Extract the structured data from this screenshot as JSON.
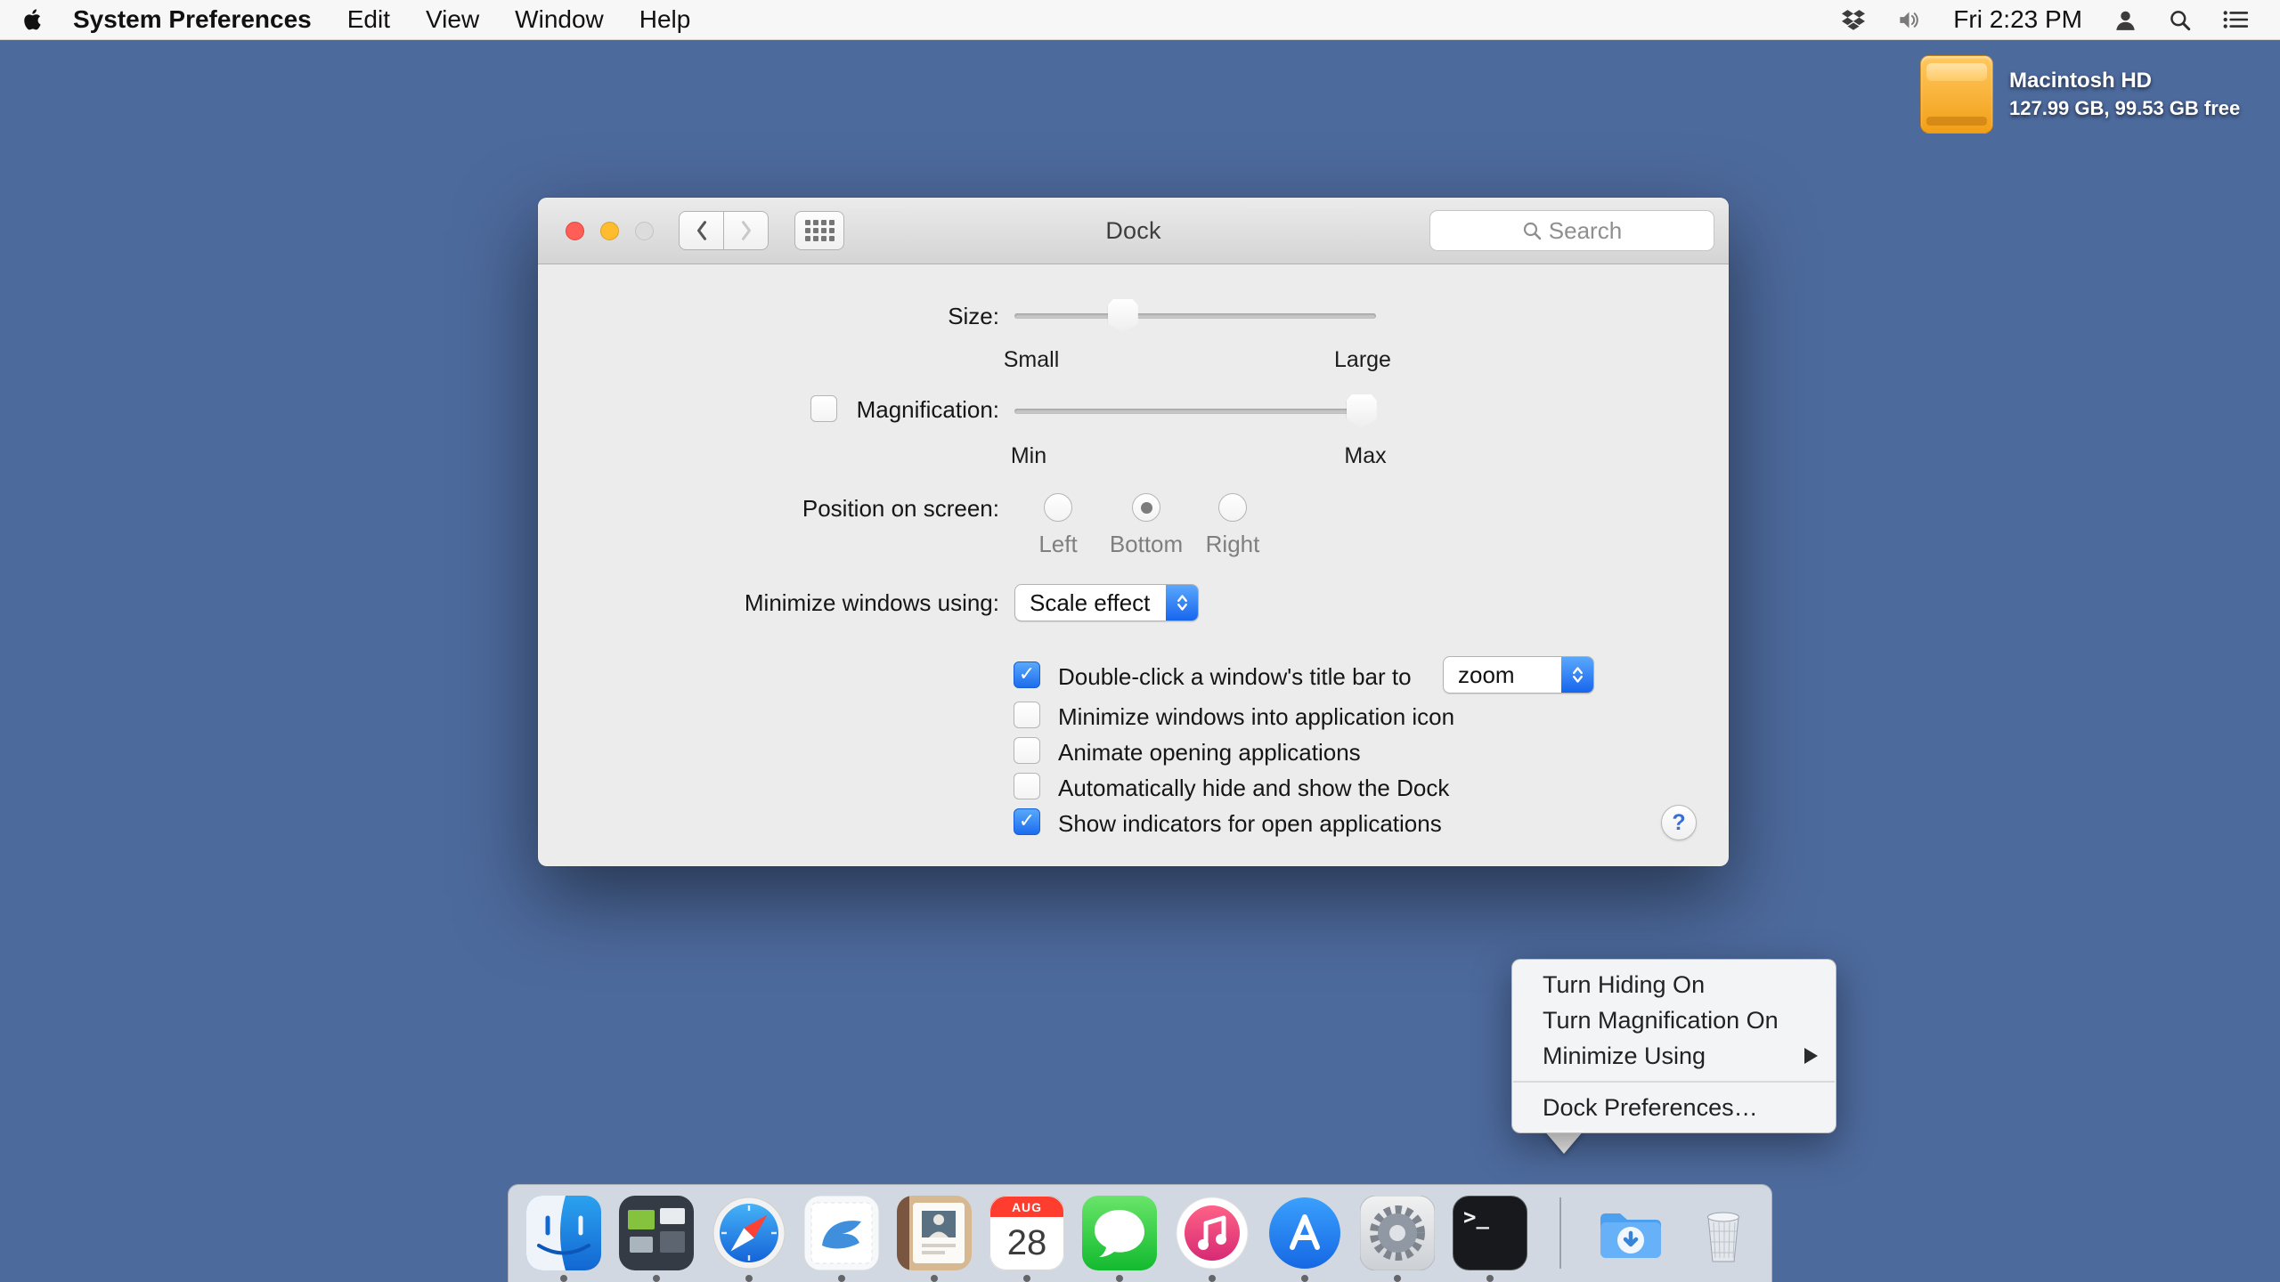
{
  "menu_bar": {
    "app_name": "System Preferences",
    "menus": [
      "Edit",
      "View",
      "Window",
      "Help"
    ],
    "clock": "Fri 2:23 PM"
  },
  "desktop": {
    "disk_name": "Macintosh HD",
    "disk_info": "127.99 GB, 99.53 GB free"
  },
  "window": {
    "title": "Dock",
    "search_placeholder": "Search",
    "size": {
      "label": "Size:",
      "min_label": "Small",
      "max_label": "Large",
      "value_pct": 30
    },
    "magnification": {
      "label": "Magnification:",
      "checked": false,
      "min_label": "Min",
      "max_label": "Max",
      "value_pct": 96
    },
    "position": {
      "label": "Position on screen:",
      "options": [
        {
          "label": "Left",
          "selected": false
        },
        {
          "label": "Bottom",
          "selected": true
        },
        {
          "label": "Right",
          "selected": false
        }
      ]
    },
    "minimize_using": {
      "label": "Minimize windows using:",
      "value": "Scale effect"
    },
    "checkboxes": [
      {
        "label": "Double-click a window's title bar to",
        "checked": true,
        "dropdown": "zoom"
      },
      {
        "label": "Minimize windows into application icon",
        "checked": false
      },
      {
        "label": "Animate opening applications",
        "checked": false
      },
      {
        "label": "Automatically hide and show the Dock",
        "checked": false
      },
      {
        "label": "Show indicators for open applications",
        "checked": true
      }
    ],
    "help_label": "?"
  },
  "context_menu": {
    "items": [
      "Turn Hiding On",
      "Turn Magnification On",
      "Minimize Using"
    ],
    "bottom_item": "Dock Preferences…"
  },
  "dock": {
    "calendar_month": "AUG",
    "calendar_day": "28",
    "terminal_prompt": ">_"
  },
  "colors": {
    "desktop_blue": "#4d6a9d",
    "accent_blue": "#1c6cee",
    "calendar_red": "#ff3d2e",
    "traffic_red": "#ff5f57",
    "traffic_yellow": "#febc2e"
  }
}
